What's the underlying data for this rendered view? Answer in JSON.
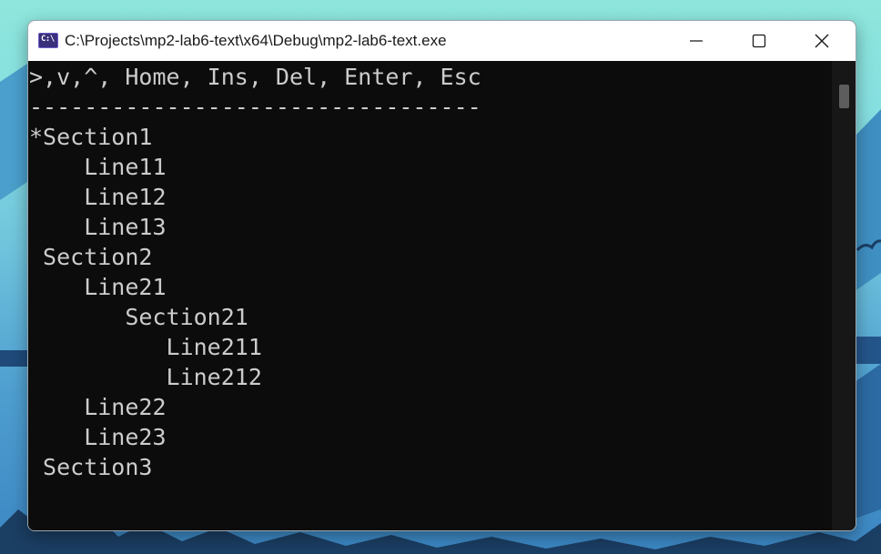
{
  "window": {
    "title": "C:\\Projects\\mp2-lab6-text\\x64\\Debug\\mp2-lab6-text.exe",
    "app_icon_text": "C:\\",
    "icon": "console-app-icon"
  },
  "controls": {
    "minimize_icon": "minimize-icon",
    "maximize_icon": "maximize-icon",
    "close_icon": "close-icon"
  },
  "console": {
    "lines": [
      ">,v,^, Home, Ins, Del, Enter, Esc",
      "---------------------------------",
      "*Section1",
      "    Line11",
      "    Line12",
      "    Line13",
      " Section2",
      "    Line21",
      "       Section21",
      "          Line211",
      "          Line212",
      "    Line22",
      "    Line23",
      " Section3"
    ],
    "text_color": "#cccccc",
    "background_color": "#0c0c0c"
  }
}
